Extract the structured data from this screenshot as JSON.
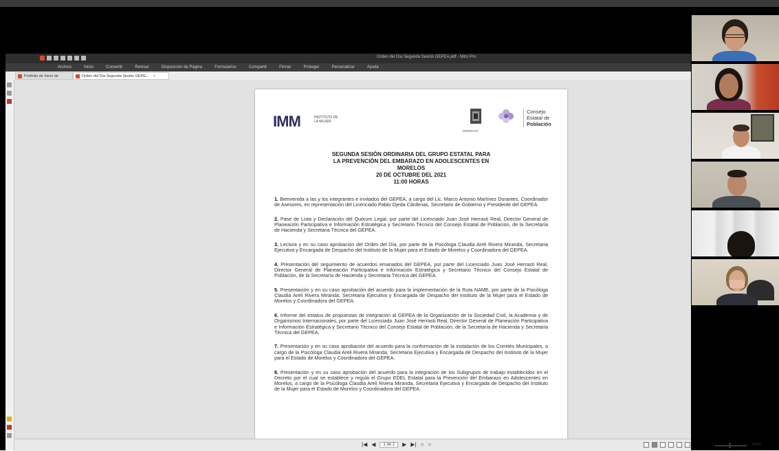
{
  "app": {
    "window_title": "Orden del Día Segunda Sesión GEPEA.pdf - Nitro Pro",
    "menu": [
      "Archivo",
      "Inicio",
      "Convertir",
      "Revisar",
      "Disposición de Página",
      "Formularios",
      "Compartir",
      "Firmar",
      "Proteger",
      "Personalizar",
      "Ayuda"
    ],
    "tabs": [
      {
        "label": "Portfolio de Inicio de Trabajo",
        "close": ""
      },
      {
        "label": "Orden del Día Segunda Sesión GEPE...",
        "close": "×"
      }
    ],
    "status": {
      "page_info": "1 de 2",
      "zoom_pct": "100%"
    }
  },
  "document": {
    "logo_imm": "IMM",
    "logo_imm_sub": "INSTITUTO DE LA MUJER",
    "seal_text": "MORELOS",
    "consejo": [
      "Consejo",
      "Estatal de",
      "Población"
    ],
    "heading": [
      "SEGUNDA SESIÓN ORDINARIA DEL GRUPO ESTATAL PARA",
      "LA PREVENCIÓN DEL EMBARAZO EN ADOLESCENTES EN",
      "MORELOS",
      "20 DE OCTUBRE DEL 2021",
      "11:00 HORAS"
    ],
    "items": [
      {
        "num": "1.",
        "text": "Bienvenida a las y los integrantes e invitados del GEPEA, a cargo del Lic. Marco Antonio Martínez Dorantes, Coordinador de Asesores, en representación del Licenciado Pablo Ojeda Cárdenas, Secretario de Gobierno y Presidente del GEPEA."
      },
      {
        "num": "2.",
        "text": "Pase de Lista y Declaración del Quórum Legal, por parte del Licenciado Juan José Herrasti Real, Director General de Planeación Participativa e Información Estratégica y Secretario Técnico del Consejo Estatal de Población, de la Secretaría de Hacienda y Secretaria Técnica del GEPEA."
      },
      {
        "num": "3.",
        "text": "Lectura y en su caso aprobación del Orden del Día, por parte de la Psicóloga Claudia Areli Rivera Miranda, Secretaria Ejecutiva y Encargada de Despacho del Instituto de la Mujer para el Estado de Morelos y Coordinadora del GEPEA."
      },
      {
        "num": "4.",
        "text": "Presentación del seguimiento de acuerdos emanados del GEPEA, por parte del Licenciado Juan José Herrasti Real, Director General de Planeación Participativa e Información Estratégica y Secretario Técnico del Consejo Estatal de Población, de la Secretaría de Hacienda y Secretaria Técnica del GEPEA."
      },
      {
        "num": "5.",
        "text": "Presentación y en su caso aprobación del acuerdo para la implementación de la Ruta NAME, por parte de la Psicóloga Claudia Areli Rivera Miranda, Secretaria Ejecutiva y Encargada de Despacho del Instituto de la Mujer para el Estado de Morelos y Coordinadora del GEPEA."
      },
      {
        "num": "6.",
        "text": "Informe del estatus de propuestas de integración al GEPEA de la Organización de la Sociedad Civil, la Academia y de Organismos Internacionales, por parte del Licenciado Juan José Herrasti Real, Director General de Planeación Participativa e Información Estratégica y Secretario Técnico del Consejo Estatal de Población, de la Secretaría de Hacienda y Secretaria Técnica del GEPEA."
      },
      {
        "num": "7.",
        "text": "Presentación y en su caso aprobación del acuerdo para la conformación de la instalación de los Comités Municipales, a cargo de la Psicóloga Claudia Areli Rivera Miranda, Secretaria Ejecutiva y Encargada de Despacho del Instituto de la Mujer para el Estado de Morelos y Coordinadora del GEPEA."
      },
      {
        "num": "8.",
        "text": "Presentación y en su caso aprobación del acuerdo para la integración de los Subgrupos de trabajo establecidos en el Decreto por el cual se establece y regula el Grupo EDEL Estatal para la Prevención del Embarazo en Adolescentes en Morelos, a cargo de la Psicóloga Claudia Areli Rivera Miranda, Secretaria Ejecutiva y Encargada de Despacho del Instituto de la Mujer para el Estado de Morelos y Coordinadora del GEPEA."
      }
    ]
  },
  "colors": {
    "brand_imm": "#2d2e63",
    "nitro_red": "#d84a2a",
    "chrome_dark": "#2d2d2d"
  },
  "participants": [
    "participant-1",
    "participant-2",
    "participant-3",
    "participant-4",
    "participant-5",
    "participant-6"
  ]
}
